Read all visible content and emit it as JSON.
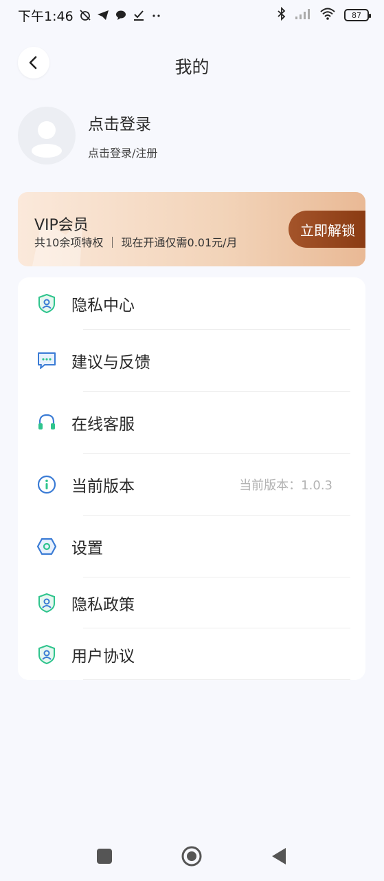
{
  "status_bar": {
    "time": "下午1:46",
    "battery": "87"
  },
  "header": {
    "title": "我的"
  },
  "profile": {
    "title": "点击登录",
    "subtitle": "点击登录/注册"
  },
  "vip": {
    "title": "VIP会员",
    "description": "共10余项特权 ｜ 现在开通仅需0.01元/月",
    "button_label": "立即解锁"
  },
  "menu": {
    "items": [
      {
        "label": "隐私中心",
        "icon": "shield-user-icon",
        "value": ""
      },
      {
        "label": "建议与反馈",
        "icon": "chat-bubble-icon",
        "value": ""
      },
      {
        "label": "在线客服",
        "icon": "headset-icon",
        "value": ""
      },
      {
        "label": "当前版本",
        "icon": "info-icon",
        "value": "当前版本：1.0.3"
      },
      {
        "label": "设置",
        "icon": "hexagon-settings-icon",
        "value": ""
      },
      {
        "label": "隐私政策",
        "icon": "shield-user-icon",
        "value": ""
      },
      {
        "label": "用户协议",
        "icon": "shield-user-icon",
        "value": ""
      }
    ]
  },
  "colors": {
    "background": "#f7f8fd",
    "icon_blue": "#3a7bd5",
    "icon_green": "#2fc48d",
    "vip_button": "#8a3b13"
  }
}
